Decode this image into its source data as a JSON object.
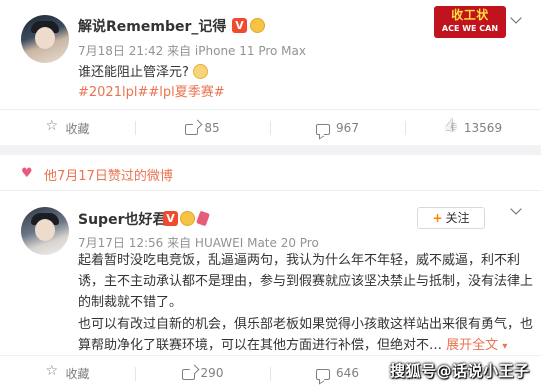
{
  "post1": {
    "author": "解说Remember_记得",
    "timestamp": "7月18日 21:42 来自 iPhone 11 Pro Max",
    "text": "谁还能阻止管泽元?",
    "hashtag": "#2021lpl##lpl夏季赛#",
    "logo_top": "收工状",
    "logo_bottom": "ACE WE CAN",
    "actions": {
      "collect": "收藏",
      "share": "85",
      "comment": "967",
      "like": "13569"
    }
  },
  "liked_bar": {
    "label": "他7月17日赞过的微博"
  },
  "post2": {
    "author": "Super也好君",
    "follow_label": "关注",
    "timestamp": "7月17日 12:56 来自 HUAWEI Mate 20 Pro",
    "lines": [
      "起着暂时没吃电竞饭，乱逼逼两句，我认为什么年不年轻，威不威逼，利不利",
      "诱，主不主动承认都不是理由，参与到假赛就应该坚决禁止与抵制，没有法律上",
      "的制裁就不错了。",
      "也可以有改过自新的机会，俱乐部老板如果觉得小孩敢这样站出来很有勇气，也",
      "算帮助净化了联赛环境，可以在其他方面进行补偿，但绝对不…"
    ],
    "expand_label": "展开全文",
    "actions": {
      "collect": "收藏",
      "share": "290",
      "comment": "646"
    }
  },
  "watermark": "搜狐号@话说小王子",
  "colors": {
    "link": "#eb7350",
    "badge": "#f14b2f",
    "heart": "#e9587d",
    "follow_plus": "#ff8200"
  }
}
